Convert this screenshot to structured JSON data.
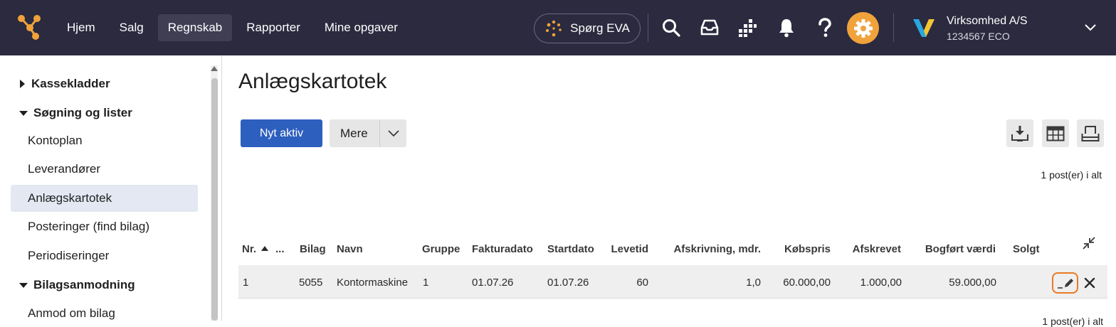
{
  "topbar": {
    "nav": [
      {
        "label": "Hjem",
        "active": false
      },
      {
        "label": "Salg",
        "active": false
      },
      {
        "label": "Regnskab",
        "active": true
      },
      {
        "label": "Rapporter",
        "active": false
      },
      {
        "label": "Mine opgaver",
        "active": false
      }
    ],
    "eva_label": "Spørg EVA",
    "company_name": "Virksomhed A/S",
    "company_id": "1234567 ECO",
    "accent_color": "#f0a23b",
    "icons": [
      "search-icon",
      "inbox-icon",
      "apps-icon",
      "bell-icon",
      "help-icon",
      "gear-icon",
      "chevron-down-icon"
    ]
  },
  "sidebar": {
    "sections": [
      {
        "label": "Kassekladder",
        "expanded": false
      },
      {
        "label": "Søgning og lister",
        "expanded": true
      },
      {
        "label": "Bilagsanmodning",
        "expanded": true
      }
    ],
    "items": [
      {
        "label": "Kontoplan",
        "active": false
      },
      {
        "label": "Leverandører",
        "active": false
      },
      {
        "label": "Anlægskartotek",
        "active": true
      },
      {
        "label": "Posteringer (find bilag)",
        "active": false
      },
      {
        "label": "Periodiseringer",
        "active": false
      },
      {
        "label": "Anmod om bilag",
        "active": false
      }
    ]
  },
  "main": {
    "title": "Anlægskartotek",
    "new_button": "Nyt aktiv",
    "more_button": "Mere",
    "count_top": "1 post(er) i alt",
    "count_bottom": "1 post(er) i alt",
    "columns": {
      "nr": "Nr.",
      "more": "...",
      "bilag": "Bilag",
      "navn": "Navn",
      "gruppe": "Gruppe",
      "fakturadato": "Fakturadato",
      "startdato": "Startdato",
      "levetid": "Levetid",
      "afskrivning": "Afskrivning, mdr.",
      "kobspris": "Købspris",
      "afskrevet": "Afskrevet",
      "bogfort": "Bogført værdi",
      "solgt": "Solgt"
    },
    "rows": [
      {
        "nr": "1",
        "bilag": "5055",
        "navn": "Kontormaskine",
        "gruppe": "1",
        "fakturadato": "01.07.26",
        "startdato": "01.07.26",
        "levetid": "60",
        "afskrivning": "1,0",
        "kobspris": "60.000,00",
        "afskrevet": "1.000,00",
        "bogfort": "59.000,00",
        "solgt": ""
      }
    ]
  }
}
